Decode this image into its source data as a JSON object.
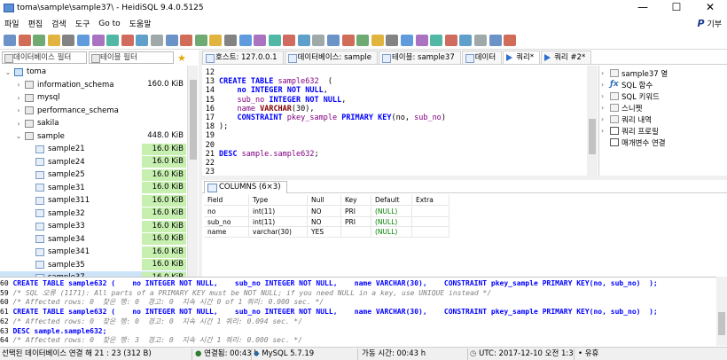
{
  "window": {
    "title": "toma\\sample\\sample37\\ - HeidiSQL 9.4.0.5125",
    "controls": {
      "minimize": "—",
      "maximize": "☐",
      "close": "✕"
    }
  },
  "menu": {
    "items": [
      "파일",
      "편집",
      "검색",
      "도구",
      "Go to",
      "도움말"
    ],
    "donate_label": "기부",
    "donate_logo": "P"
  },
  "toolbar": {
    "buttons": [
      "connect-icon",
      "disconnect-icon",
      "copy-icon",
      "paste-icon",
      "undo-icon",
      "redo-icon",
      "export-icon",
      "import-icon",
      "users-icon",
      "refresh-icon",
      "settings-icon",
      "filter-icon",
      "find-icon",
      "help-icon",
      "stop-icon",
      "first-icon",
      "prev-icon",
      "next-icon",
      "last-icon",
      "cancel-icon",
      "ok-icon",
      "delete-icon",
      "run-icon",
      "run-line-icon",
      "explain-icon",
      "save-icon",
      "load-icon",
      "sql-help-icon",
      "format-icon",
      "edit-icon",
      "warning-icon",
      "null-icon",
      "wrap-icon",
      "link-icon",
      "close-icon"
    ]
  },
  "left_panel": {
    "db_filter_placeholder": "데이터베이스 필터",
    "table_filter_placeholder": "테이블 필터",
    "tree": [
      {
        "label": "toma",
        "size": "",
        "level": 0,
        "expanded": true,
        "kind": "server"
      },
      {
        "label": "information_schema",
        "size": "160.0 KiB",
        "level": 1,
        "kind": "db"
      },
      {
        "label": "mysql",
        "size": "",
        "level": 1,
        "kind": "db"
      },
      {
        "label": "performance_schema",
        "size": "",
        "level": 1,
        "kind": "db"
      },
      {
        "label": "sakila",
        "size": "",
        "level": 1,
        "kind": "db"
      },
      {
        "label": "sample",
        "size": "448.0 KiB",
        "level": 1,
        "kind": "db",
        "expanded": true
      },
      {
        "label": "sample21",
        "size": "16.0 KiB",
        "level": 2,
        "kind": "table"
      },
      {
        "label": "sample24",
        "size": "16.0 KiB",
        "level": 2,
        "kind": "table"
      },
      {
        "label": "sample25",
        "size": "16.0 KiB",
        "level": 2,
        "kind": "table"
      },
      {
        "label": "sample31",
        "size": "16.0 KiB",
        "level": 2,
        "kind": "table"
      },
      {
        "label": "sample311",
        "size": "16.0 KiB",
        "level": 2,
        "kind": "table"
      },
      {
        "label": "sample32",
        "size": "16.0 KiB",
        "level": 2,
        "kind": "table"
      },
      {
        "label": "sample33",
        "size": "16.0 KiB",
        "level": 2,
        "kind": "table"
      },
      {
        "label": "sample34",
        "size": "16.0 KiB",
        "level": 2,
        "kind": "table"
      },
      {
        "label": "sample341",
        "size": "16.0 KiB",
        "level": 2,
        "kind": "table"
      },
      {
        "label": "sample35",
        "size": "16.0 KiB",
        "level": 2,
        "kind": "table"
      },
      {
        "label": "sample37",
        "size": "16.0 KiB",
        "level": 2,
        "kind": "table",
        "selected": true
      }
    ]
  },
  "tabs": [
    {
      "label": "호스트: 127.0.0.1",
      "type": "host"
    },
    {
      "label": "데이터베이스: sample",
      "type": "db"
    },
    {
      "label": "테이블: sample37",
      "type": "table"
    },
    {
      "label": "데이터",
      "type": "data"
    },
    {
      "label": "쿼리*",
      "type": "query",
      "active": true
    },
    {
      "label": "쿼리 #2*",
      "type": "query"
    }
  ],
  "editor": {
    "lines": [
      {
        "n": "12",
        "tokens": []
      },
      {
        "n": "13",
        "tokens": [
          [
            "kw",
            "CREATE TABLE "
          ],
          [
            "id",
            "sample632"
          ],
          [
            "",
            "  ("
          ]
        ]
      },
      {
        "n": "14",
        "tokens": [
          [
            "",
            "    "
          ],
          [
            "kw",
            "no INTEGER NOT NULL"
          ],
          [
            "",
            ","
          ]
        ]
      },
      {
        "n": "15",
        "tokens": [
          [
            "",
            "    "
          ],
          [
            "id",
            "sub_no"
          ],
          [
            "kw",
            " INTEGER NOT NULL"
          ],
          [
            "",
            ","
          ]
        ]
      },
      {
        "n": "16",
        "tokens": [
          [
            "",
            "    "
          ],
          [
            "id",
            "name"
          ],
          [
            "ty",
            " VARCHAR"
          ],
          [
            "",
            "(30),"
          ]
        ]
      },
      {
        "n": "17",
        "tokens": [
          [
            "",
            "    "
          ],
          [
            "kw",
            "CONSTRAINT "
          ],
          [
            "id",
            "pkey_sample"
          ],
          [
            "kw",
            " PRIMARY KEY"
          ],
          [
            "",
            "(no, "
          ],
          [
            "id",
            "sub_no"
          ],
          [
            "",
            ")"
          ]
        ]
      },
      {
        "n": "18",
        "tokens": [
          [
            "",
            ");"
          ]
        ]
      },
      {
        "n": "19",
        "tokens": []
      },
      {
        "n": "20",
        "tokens": []
      },
      {
        "n": "21",
        "tokens": [
          [
            "kw",
            "DESC "
          ],
          [
            "id",
            "sample.sample632"
          ],
          [
            "",
            ";"
          ]
        ]
      },
      {
        "n": "22",
        "tokens": []
      },
      {
        "n": "23",
        "tokens": []
      }
    ]
  },
  "helper": {
    "items": [
      {
        "label": "sample37 열",
        "icon": "table",
        "exp": "›"
      },
      {
        "label": "SQL 함수",
        "icon": "fx",
        "exp": "›"
      },
      {
        "label": "SQL 키워드",
        "icon": "key",
        "exp": "›"
      },
      {
        "label": "스니펫",
        "icon": "folder",
        "exp": "›"
      },
      {
        "label": "쿼리 내역",
        "icon": "history",
        "exp": "›"
      },
      {
        "label": "쿼리 프로필",
        "icon": "chk",
        "exp": "›"
      },
      {
        "label": "매개변수 연결",
        "icon": "chk",
        "exp": ""
      }
    ]
  },
  "results": {
    "tab_label": "COLUMNS (6×3)",
    "columns": [
      "Field",
      "Type",
      "Null",
      "Key",
      "Default",
      "Extra"
    ],
    "rows": [
      [
        "no",
        "int(11)",
        "NO",
        "PRI",
        "(NULL)",
        ""
      ],
      [
        "sub_no",
        "int(11)",
        "NO",
        "PRI",
        "(NULL)",
        ""
      ],
      [
        "name",
        "varchar(30)",
        "YES",
        "",
        "(NULL)",
        ""
      ]
    ]
  },
  "sql_log": [
    {
      "p": "60",
      "t": "CREATE TABLE sample632 (    no INTEGER NOT NULL,    sub_no INTEGER NOT NULL,    name VARCHAR(30),    CONSTRAINT pkey_sample PRIMARY KEY(no, sub_no)  );",
      "c": false
    },
    {
      "p": "59",
      "t": "/* SQL 오류 (1171): All parts of a PRIMARY KEY must be NOT NULL; if you need NULL in a key, use UNIQUE instead */",
      "c": true
    },
    {
      "p": "60",
      "t": "/* Affected rows: 0  찾은 행: 0  경고: 0  지속 시간 0 of 1 쿼리: 0.000 sec. */",
      "c": true
    },
    {
      "p": "61",
      "t": "CREATE TABLE sample632 (    no INTEGER NOT NULL,    sub_no INTEGER NOT NULL,    name VARCHAR(30),    CONSTRAINT pkey_sample PRIMARY KEY(no, sub_no)  );",
      "c": false
    },
    {
      "p": "62",
      "t": "/* Affected rows: 0  찾은 행: 0  경고: 0  지속 시간 1 쿼리: 0.094 sec. */",
      "c": true
    },
    {
      "p": "63",
      "t": "DESC sample.sample632;",
      "c": false
    },
    {
      "p": "64",
      "t": "/* Affected rows: 0  찾은 행: 3  경고: 0  지속 시간 1 쿼리: 0.000 sec. */",
      "c": true
    }
  ],
  "status": {
    "connection": "선택된 데이터베이스 연결 해 21 : 23 (312 B)",
    "connected": "연결됨: 00:43 h",
    "server": "MySQL 5.7.19",
    "uptime": "가동 시간: 00:43 h",
    "utc": "UTC: 2017-12-10 오전 1:3",
    "state": "유휴"
  },
  "colors": {
    "green_size": "#c6efb0",
    "keyword": "#0000ff",
    "identifier": "#800080",
    "comment": "#808080"
  }
}
